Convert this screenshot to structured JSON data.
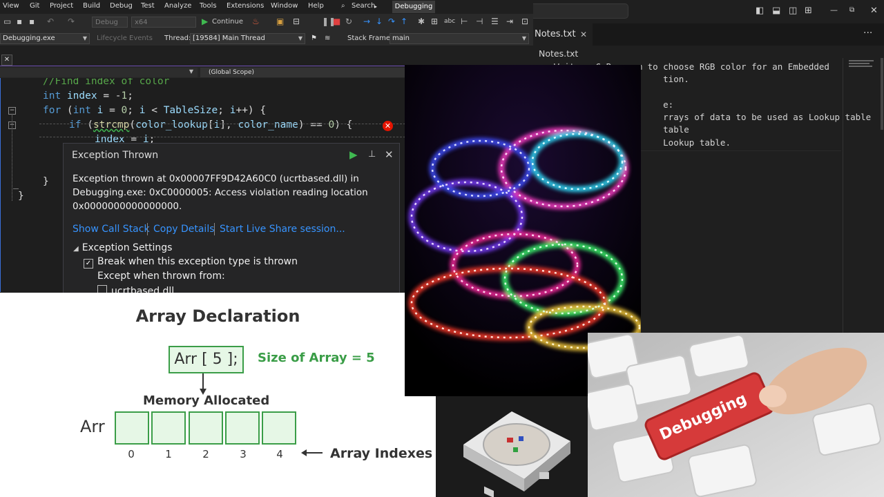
{
  "menu": {
    "items": [
      "View",
      "Git",
      "Project",
      "Build",
      "Debug",
      "Test",
      "Analyze",
      "Tools",
      "Extensions",
      "Window",
      "Help"
    ],
    "search": "Search",
    "mode_badge": "Debugging"
  },
  "toolbar": {
    "config": "Debug",
    "platform": "x64",
    "continue_label": "Continue"
  },
  "debug_bar": {
    "process": "Debugging.exe",
    "lifecycle": "Lifecycle Events",
    "thread_label": "Thread:",
    "thread_value": "[19584] Main Thread",
    "stack_label": "Stack Frame:",
    "stack_value": "main"
  },
  "navbar": {
    "scope": "(Global Scope)"
  },
  "code": {
    "comment": "//Find index of color",
    "error_marker": "✕"
  },
  "exception": {
    "title": "Exception Thrown",
    "message_line1": "Exception thrown at 0x00007FF9D42A60C0 (ucrtbased.dll) in",
    "message_line2": "Debugging.exe: 0xC0000005: Access violation reading location",
    "message_line3": "0x0000000000000000.",
    "link_call_stack": "Show Call Stack",
    "link_copy": "Copy Details",
    "link_share": "Start Live Share session...",
    "settings": "Exception Settings",
    "break_option": "Break when this exception type is thrown",
    "except_label": "Except when thrown from:",
    "dll_option": "ucrtbased.dll"
  },
  "notes": {
    "tab_label": "Notes.txt",
    "breadcrumb": "Notes.txt",
    "lines": [
      "    Write a C Program to choose RGB color for an Embedded",
      "                         tion.",
      "",
      "                         e:",
      "                         rrays of data to be used as Lookup table",
      "                         table",
      "                         Lookup table."
    ]
  },
  "array_diagram": {
    "title": "Array Declaration",
    "declaration": "Arr [ 5 ];",
    "size_label": "Size of Array = 5",
    "memory_label": "Memory Allocated",
    "array_name": "Arr",
    "indexes": [
      "0",
      "1",
      "2",
      "3",
      "4"
    ],
    "indexes_label": "Array Indexes"
  },
  "keyboard_photo": {
    "key_label": "Debugging"
  },
  "colors": {
    "accent_green": "#3a9d47",
    "link_blue": "#3794ff",
    "error_red": "#e51400",
    "continue_green": "#3fb950"
  }
}
